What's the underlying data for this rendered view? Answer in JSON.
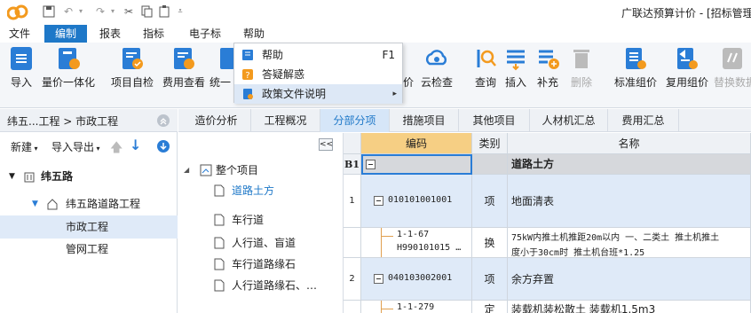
{
  "window": {
    "title": "广联达预算计价 - [招标管理"
  },
  "menubar": {
    "items": [
      "文件",
      "编制",
      "报表",
      "指标",
      "电子标",
      "帮助"
    ],
    "active": "编制"
  },
  "ribbon": {
    "buttons": [
      "导入",
      "量价一体化",
      "项目自检",
      "费用查看",
      "统一",
      "云检查",
      "查询",
      "插入",
      "补充",
      "删除",
      "标准组价",
      "复用组价",
      "替换数据"
    ],
    "partial_label": "价"
  },
  "help_menu": {
    "items": [
      {
        "label": "帮助",
        "shortcut": "F1"
      },
      {
        "label": "答疑解惑",
        "shortcut": ""
      },
      {
        "label": "政策文件说明",
        "shortcut": "▸"
      }
    ]
  },
  "left_panel": {
    "breadcrumb": "纬五...工程 > 市政工程",
    "new_label": "新建",
    "import_export_label": "导入导出",
    "tree": [
      {
        "label": "纬五路",
        "level": 0
      },
      {
        "label": "纬五路道路工程",
        "level": 1
      },
      {
        "label": "市政工程",
        "level": 2,
        "selected": true
      },
      {
        "label": "管网工程",
        "level": 2
      }
    ]
  },
  "tabs": {
    "items": [
      "造价分析",
      "工程概况",
      "分部分项",
      "措施项目",
      "其他项目",
      "人材机汇总",
      "费用汇总"
    ],
    "active": "分部分项"
  },
  "project_tree": {
    "root": "整个项目",
    "items": [
      "道路土方",
      "车行道",
      "人行道、盲道",
      "车行道路缘石",
      "人行道路缘石、…"
    ],
    "selected": "道路土方",
    "collapse_label": "<<"
  },
  "grid": {
    "columns": [
      "",
      "编码",
      "类别",
      "名称"
    ],
    "rows": [
      {
        "idx": "B1",
        "code": "",
        "type": "",
        "name": "道路土方",
        "kind": "section"
      },
      {
        "idx": "1",
        "code": "010101001001",
        "type": "项",
        "name": "地面清表",
        "kind": "item"
      },
      {
        "idx": "",
        "code": "1-1-67",
        "code2": "H990101015 …",
        "type": "换",
        "name": "75kW内推土机推距20m以内 一、二类土  推土机推土",
        "name2": "度小于30cm时 推土机台班*1.25",
        "kind": "sub"
      },
      {
        "idx": "2",
        "code": "040103002001",
        "type": "项",
        "name": "余方弃置",
        "kind": "item"
      },
      {
        "idx": "",
        "code": "1-1-279",
        "type": "定",
        "name": "装载机装松散土 装载机1.5m3",
        "kind": "sub2"
      }
    ]
  },
  "colors": {
    "accent": "#1e78c8",
    "highlight": "#f6cf84"
  }
}
